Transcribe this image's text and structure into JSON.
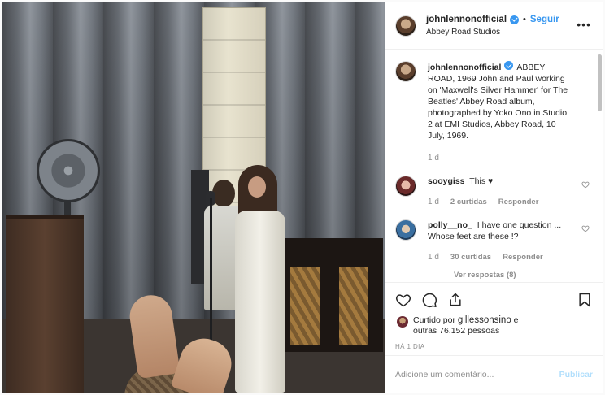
{
  "post": {
    "author": "johnlennonofficial",
    "follow_label": "Seguir",
    "separator": "•",
    "location": "Abbey Road Studios",
    "more_label": "•••"
  },
  "caption": {
    "username": "johnlennonofficial",
    "text": "ABBEY ROAD, 1969 John and Paul working on 'Maxwell's Silver Hammer' for The Beatles' Abbey Road album, photographed by Yoko Ono in Studio 2 at EMI Studios, Abbey Road, 10 July, 1969.",
    "time": "1 d"
  },
  "comments": [
    {
      "username": "sooygiss",
      "text": "This ♥",
      "time": "1 d",
      "likes": "2 curtidas",
      "reply_label": "Responder"
    },
    {
      "username": "polly__no_",
      "text": "I have one question ... Whose feet are these !?",
      "time": "1 d",
      "likes": "30 curtidas",
      "reply_label": "Responder",
      "view_replies": "Ver respostas (8)"
    }
  ],
  "likes_summary": {
    "prefix": "Curtido por",
    "user": "gillessonsino",
    "conjunction": "e",
    "others": "outras 76.152 pessoas"
  },
  "time_ago": "HÁ 1 DIA",
  "comment_box": {
    "placeholder": "Adicione um comentário...",
    "publish_label": "Publicar"
  },
  "colors": {
    "accent": "#3897f0",
    "publish_disabled": "#b2dffc",
    "muted": "#8e8e8e"
  },
  "icons": [
    "heart-icon",
    "comment-icon",
    "share-icon",
    "bookmark-icon",
    "verified-icon",
    "more-icon"
  ]
}
